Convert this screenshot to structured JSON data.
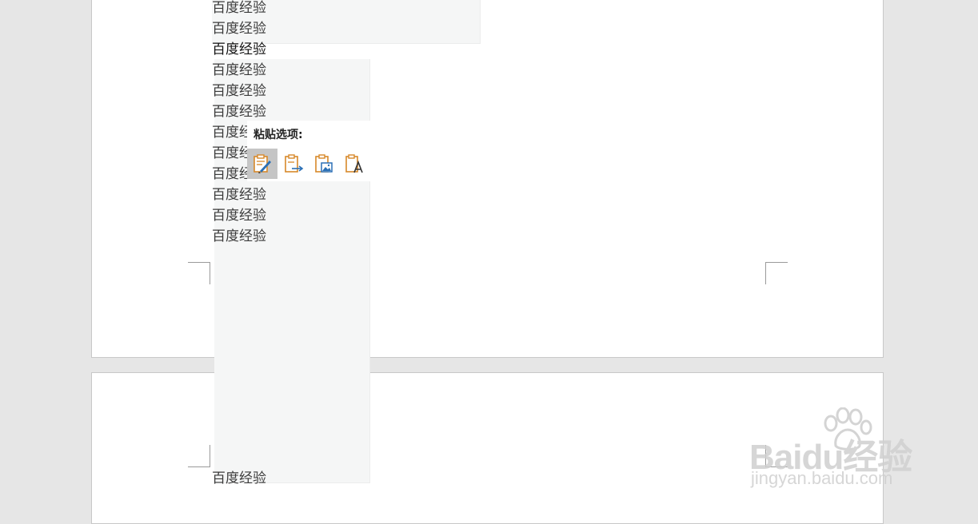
{
  "document": {
    "page1_lines": [
      "百度经验",
      "百度经验",
      "百度经验",
      "百度经验",
      "百度经验",
      "百度经验",
      "百度经验",
      "百度经验",
      "百度经验",
      "百度经验",
      "百度经验",
      "百度经验"
    ],
    "page2_lines": [
      "百度经验"
    ]
  },
  "paste_menu": {
    "title": "粘贴选项:",
    "options": [
      {
        "icon": "keep-source-formatting-icon",
        "active": true
      },
      {
        "icon": "merge-formatting-icon",
        "active": false
      },
      {
        "icon": "paste-as-picture-icon",
        "active": false
      },
      {
        "icon": "keep-text-only-icon",
        "active": false
      }
    ]
  },
  "watermark": {
    "brand": "Baidu经验",
    "url": "jingyan.baidu.com"
  },
  "colors": {
    "background": "#e6e6e6",
    "page": "#ffffff",
    "paste_icon_accent": "#d7892a",
    "paste_icon_blue": "#2a6fb6",
    "selected_button": "#c5c5c5"
  }
}
